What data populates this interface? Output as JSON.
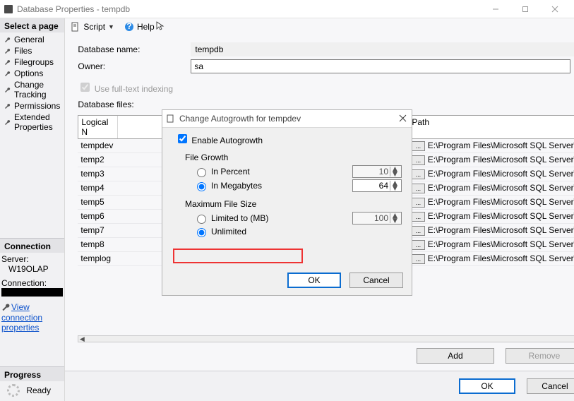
{
  "window": {
    "title": "Database Properties - tempdb"
  },
  "sidebar": {
    "header": "Select a page",
    "pages": [
      "General",
      "Files",
      "Filegroups",
      "Options",
      "Change Tracking",
      "Permissions",
      "Extended Properties"
    ],
    "connection": {
      "header": "Connection",
      "server_label": "Server:",
      "server_value": "W19OLAP",
      "connection_label": "Connection:",
      "view_props_link": "View connection properties"
    },
    "progress": {
      "header": "Progress",
      "status": "Ready"
    }
  },
  "toolbar": {
    "script": "Script",
    "help": "Help"
  },
  "form": {
    "db_name_label": "Database name:",
    "db_name_value": "tempdb",
    "owner_label": "Owner:",
    "owner_value": "sa",
    "fulltext_label": "Use full-text indexing",
    "files_label": "Database files:",
    "col_logical": "Logical N",
    "col_path": "Path"
  },
  "files": [
    {
      "logical": "tempdev",
      "path": "E:\\Program Files\\Microsoft SQL Server\\MS"
    },
    {
      "logical": "temp2",
      "path": "E:\\Program Files\\Microsoft SQL Server\\MS"
    },
    {
      "logical": "temp3",
      "path": "E:\\Program Files\\Microsoft SQL Server\\MS"
    },
    {
      "logical": "temp4",
      "path": "E:\\Program Files\\Microsoft SQL Server\\MS"
    },
    {
      "logical": "temp5",
      "path": "E:\\Program Files\\Microsoft SQL Server\\MS"
    },
    {
      "logical": "temp6",
      "path": "E:\\Program Files\\Microsoft SQL Server\\MS"
    },
    {
      "logical": "temp7",
      "path": "E:\\Program Files\\Microsoft SQL Server\\MS"
    },
    {
      "logical": "temp8",
      "path": "E:\\Program Files\\Microsoft SQL Server\\MS"
    },
    {
      "logical": "templog",
      "path": "E:\\Program Files\\Microsoft SQL Server\\MS"
    }
  ],
  "modal": {
    "title": "Change Autogrowth for tempdev",
    "enable_label": "Enable Autogrowth",
    "file_growth_header": "File Growth",
    "in_percent": "In Percent",
    "in_megabytes": "In Megabytes",
    "percent_val": "10",
    "mb_val": "64",
    "max_header": "Maximum File Size",
    "limited_label": "Limited to (MB)",
    "limited_val": "100",
    "unlimited_label": "Unlimited",
    "ok": "OK",
    "cancel": "Cancel"
  },
  "buttons": {
    "add": "Add",
    "remove": "Remove",
    "ok": "OK",
    "cancel": "Cancel"
  }
}
